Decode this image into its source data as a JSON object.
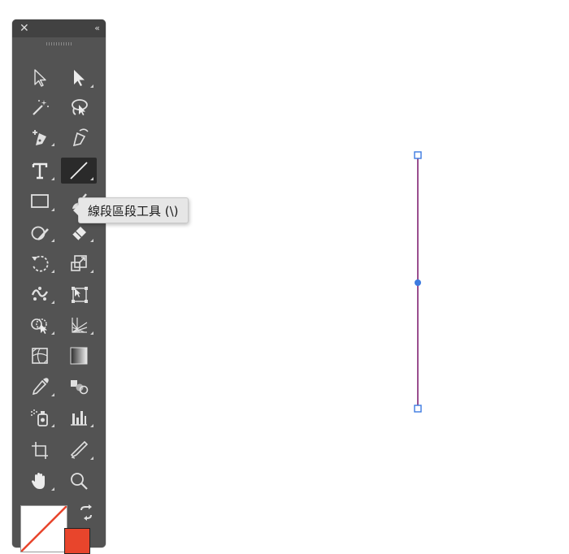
{
  "toolbar": {
    "close_label": "✕",
    "collapse_label": "‹‹",
    "tools": [
      {
        "name": "selection-tool",
        "icon": "selection-arrow-icon"
      },
      {
        "name": "direct-selection-tool",
        "icon": "direct-selection-arrow-icon"
      },
      {
        "name": "magic-wand-tool",
        "icon": "magic-wand-icon"
      },
      {
        "name": "lasso-tool",
        "icon": "lasso-icon"
      },
      {
        "name": "pen-tool",
        "icon": "pen-plus-icon"
      },
      {
        "name": "curvature-tool",
        "icon": "curvature-pen-icon"
      },
      {
        "name": "type-tool",
        "icon": "type-icon"
      },
      {
        "name": "line-segment-tool",
        "icon": "line-segment-icon",
        "selected": true
      },
      {
        "name": "rectangle-tool",
        "icon": "rectangle-icon"
      },
      {
        "name": "paintbrush-tool",
        "icon": "paintbrush-icon"
      },
      {
        "name": "shaper-tool",
        "icon": "shaper-icon"
      },
      {
        "name": "eraser-tool",
        "icon": "eraser-icon"
      },
      {
        "name": "rotate-tool",
        "icon": "rotate-icon"
      },
      {
        "name": "scale-tool",
        "icon": "scale-icon"
      },
      {
        "name": "puppet-warp-tool",
        "icon": "puppet-warp-icon"
      },
      {
        "name": "free-transform-tool",
        "icon": "free-transform-icon"
      },
      {
        "name": "shape-builder-tool",
        "icon": "shape-builder-icon"
      },
      {
        "name": "perspective-grid-tool",
        "icon": "perspective-grid-icon"
      },
      {
        "name": "mesh-tool",
        "icon": "mesh-icon"
      },
      {
        "name": "gradient-tool",
        "icon": "gradient-icon"
      },
      {
        "name": "eyedropper-tool",
        "icon": "eyedropper-icon"
      },
      {
        "name": "blend-tool",
        "icon": "blend-icon"
      },
      {
        "name": "symbol-sprayer-tool",
        "icon": "symbol-sprayer-icon"
      },
      {
        "name": "column-graph-tool",
        "icon": "column-graph-icon"
      },
      {
        "name": "artboard-tool",
        "icon": "artboard-icon"
      },
      {
        "name": "slice-tool",
        "icon": "slice-knife-icon"
      },
      {
        "name": "hand-tool",
        "icon": "hand-icon"
      },
      {
        "name": "zoom-tool",
        "icon": "zoom-magnifier-icon"
      }
    ],
    "fill_color": "#ffffff",
    "stroke_color": "#e8452c"
  },
  "tooltip": {
    "text": "線段區段工具 (\\)"
  },
  "canvas": {
    "line_color": "#9a4f8e",
    "handle_color": "#3d7be0"
  }
}
